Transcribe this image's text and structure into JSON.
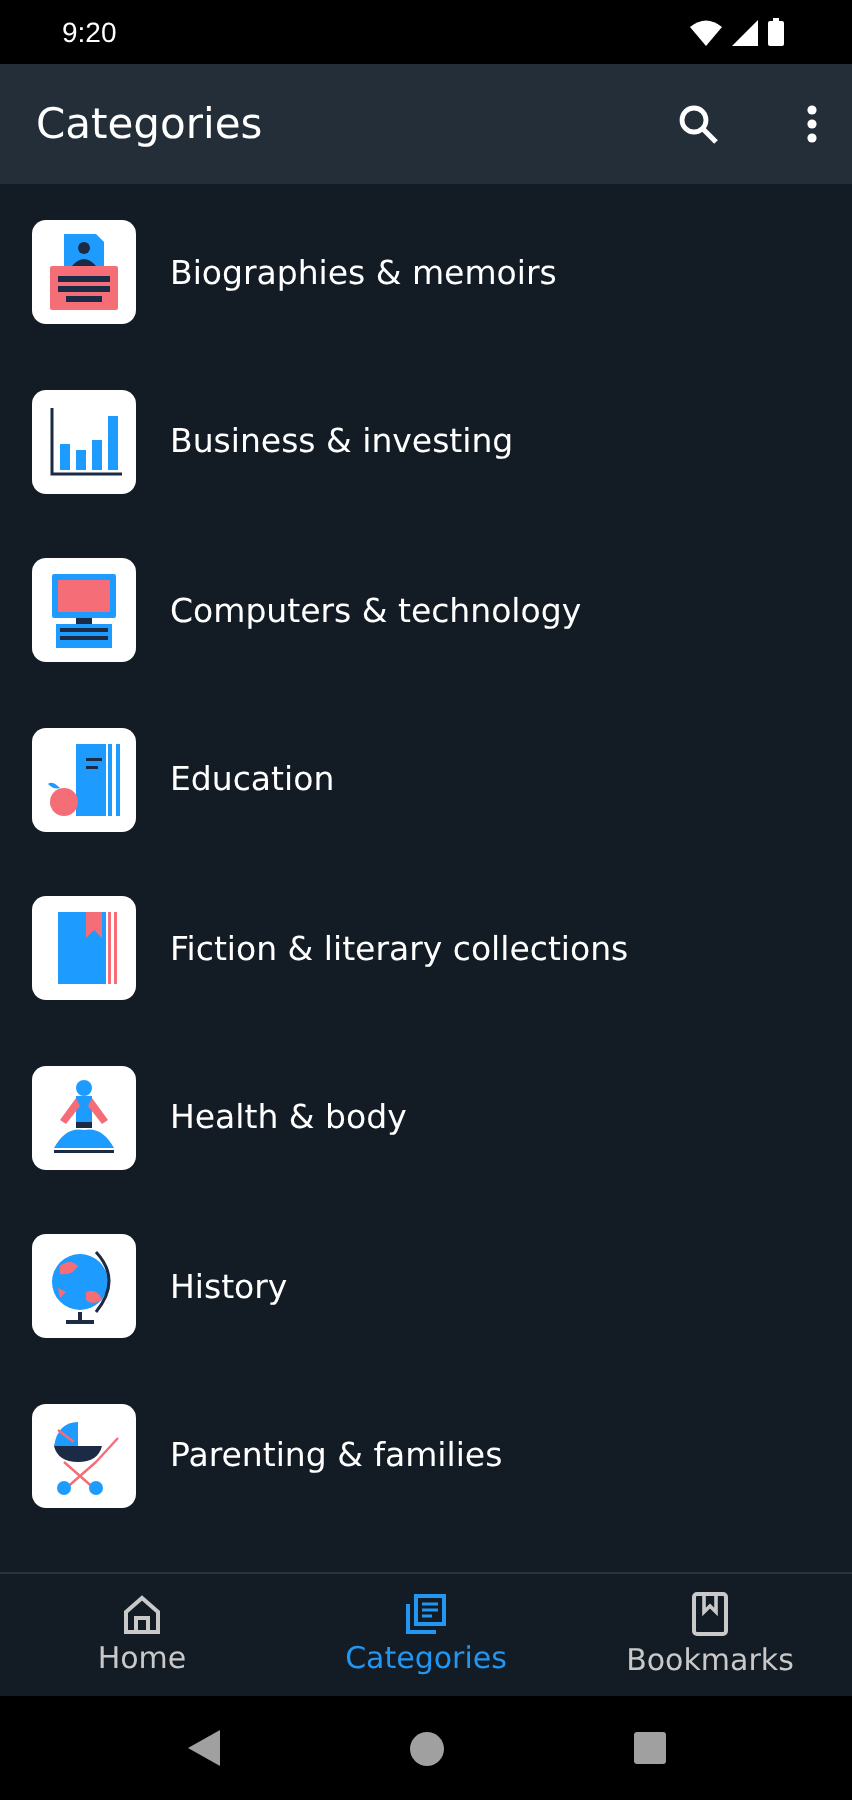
{
  "status_bar": {
    "time": "9:20"
  },
  "app_bar": {
    "title": "Categories"
  },
  "categories": [
    {
      "label": "Biographies & memoirs",
      "kind": "typewriter"
    },
    {
      "label": "Business & investing",
      "kind": "chart"
    },
    {
      "label": "Computers & technology",
      "kind": "computer"
    },
    {
      "label": "Education",
      "kind": "textbook"
    },
    {
      "label": "Fiction & literary collections",
      "kind": "book"
    },
    {
      "label": "Health & body",
      "kind": "meditation"
    },
    {
      "label": "History",
      "kind": "globe"
    },
    {
      "label": "Parenting & families",
      "kind": "stroller"
    }
  ],
  "bottom_nav": [
    {
      "label": "Home",
      "kind": "home",
      "selected": false
    },
    {
      "label": "Categories",
      "kind": "categories",
      "selected": true
    },
    {
      "label": "Bookmarks",
      "kind": "bookmarks",
      "selected": false
    }
  ]
}
